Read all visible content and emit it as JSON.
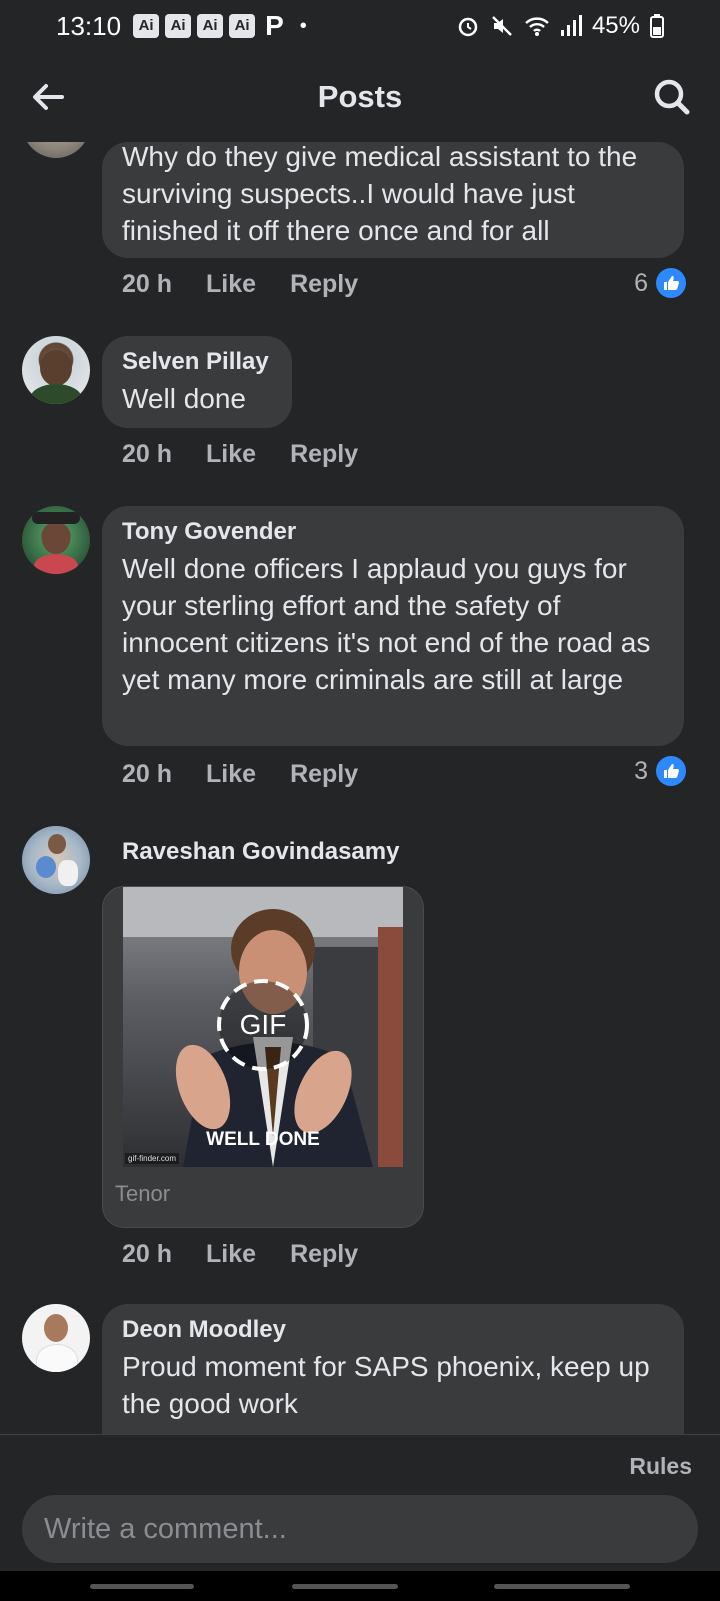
{
  "status_bar": {
    "time": "13:10",
    "badges": [
      "Ai",
      "Ai",
      "Ai",
      "Ai"
    ],
    "extra_icon": "P",
    "dot": "•",
    "battery": "45%"
  },
  "header": {
    "title": "Posts",
    "back_icon": "arrow-left-icon",
    "search_icon": "search-icon"
  },
  "comments": [
    {
      "author": "",
      "text": "Why do they give medical assistant to the surviving suspects..I would have just finished it off there once and for all",
      "time": "20 h",
      "like": "Like",
      "reply": "Reply",
      "reactions": "6"
    },
    {
      "author": "Selven Pillay",
      "text": "Well done",
      "time": "20 h",
      "like": "Like",
      "reply": "Reply"
    },
    {
      "author": "Tony Govender",
      "text": "Well done officers I applaud you guys for your sterling effort and the safety of innocent citizens it's not end of the road as yet many more criminals are still at large",
      "time": "20 h",
      "like": "Like",
      "reply": "Reply",
      "reactions": "3"
    },
    {
      "author": "Raveshan Govindasamy",
      "gif_label": "GIF",
      "gif_caption": "WELL DONE",
      "gif_watermark": "gif-finder.com",
      "gif_source": "Tenor",
      "time": "20 h",
      "like": "Like",
      "reply": "Reply"
    },
    {
      "author": "Deon Moodley",
      "text": "Proud moment for SAPS phoenix, keep up the good work"
    }
  ],
  "composer": {
    "rules_label": "Rules",
    "placeholder": "Write a comment..."
  },
  "colors": {
    "background": "#242526",
    "bubble": "#3a3b3c",
    "like_blue": "#2e89ff",
    "secondary_text": "#b0b3b8"
  }
}
